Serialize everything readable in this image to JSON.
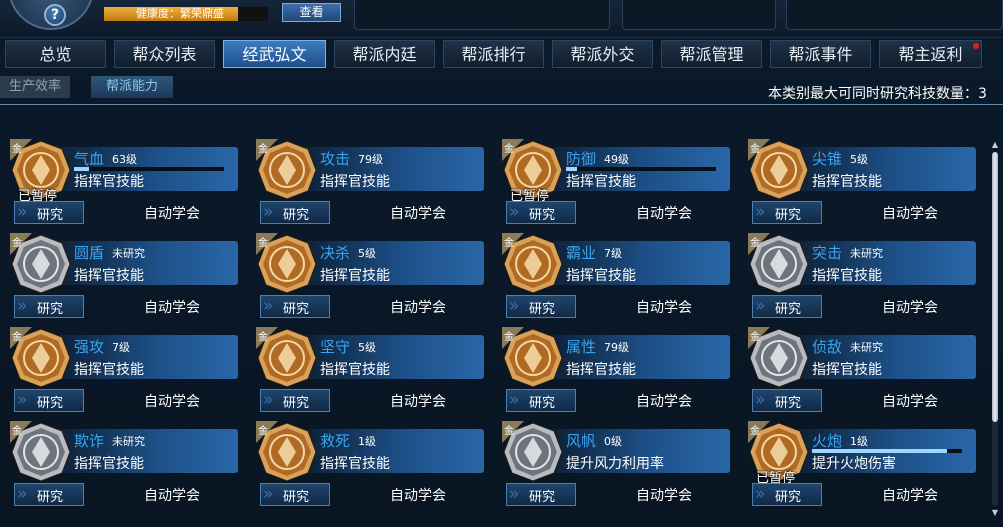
{
  "header": {
    "help_glyph": "?",
    "health_label": "健康度：繁荣鼎盛",
    "health_ratio": 0.82,
    "view_button": "查看"
  },
  "tabs": [
    {
      "label": "总览",
      "active": false
    },
    {
      "label": "帮众列表",
      "active": false
    },
    {
      "label": "经武弘文",
      "active": true
    },
    {
      "label": "帮派内廷",
      "active": false
    },
    {
      "label": "帮派排行",
      "active": false
    },
    {
      "label": "帮派外交",
      "active": false
    },
    {
      "label": "帮派管理",
      "active": false
    },
    {
      "label": "帮派事件",
      "active": false
    },
    {
      "label": "帮主返利",
      "active": false,
      "notification": true
    }
  ],
  "subtabs": {
    "production": "生产效率",
    "ability": "帮派能力"
  },
  "capacity_text": "本类别最大可同时研究科技数量：3",
  "skills": [
    {
      "grade": "金",
      "name": "气血",
      "level": "63级",
      "desc": "指挥官技能",
      "paused": "已暂停",
      "progress": 0.1,
      "research": "研究",
      "auto": "自动学会",
      "icon": "blood-icon",
      "gold": true
    },
    {
      "grade": "金",
      "name": "攻击",
      "level": "79级",
      "desc": "指挥官技能",
      "research": "研究",
      "auto": "自动学会",
      "icon": "attack-icon",
      "gold": true
    },
    {
      "grade": "金",
      "name": "防御",
      "level": "49级",
      "desc": "指挥官技能",
      "paused": "已暂停",
      "progress": 0.07,
      "research": "研究",
      "auto": "自动学会",
      "icon": "defense-icon",
      "gold": true
    },
    {
      "grade": "金",
      "name": "尖锥",
      "level": "5级",
      "desc": "指挥官技能",
      "research": "研究",
      "auto": "自动学会",
      "icon": "cone-icon",
      "gold": true
    },
    {
      "grade": "金",
      "name": "圆盾",
      "level": "未研究",
      "desc": "指挥官技能",
      "research": "研究",
      "auto": "自动学会",
      "icon": "round-shield-icon",
      "gold": false
    },
    {
      "grade": "金",
      "name": "决杀",
      "level": "5级",
      "desc": "指挥官技能",
      "research": "研究",
      "auto": "自动学会",
      "icon": "kill-icon",
      "gold": true
    },
    {
      "grade": "金",
      "name": "霸业",
      "level": "7级",
      "desc": "指挥官技能",
      "research": "研究",
      "auto": "自动学会",
      "icon": "dominion-icon",
      "gold": true
    },
    {
      "grade": "金",
      "name": "突击",
      "level": "未研究",
      "desc": "指挥官技能",
      "research": "研究",
      "auto": "自动学会",
      "icon": "assault-icon",
      "gold": false
    },
    {
      "grade": "金",
      "name": "强攻",
      "level": "7级",
      "desc": "指挥官技能",
      "research": "研究",
      "auto": "自动学会",
      "icon": "strong-attack-icon",
      "gold": true
    },
    {
      "grade": "金",
      "name": "坚守",
      "level": "5级",
      "desc": "指挥官技能",
      "research": "研究",
      "auto": "自动学会",
      "icon": "hold-icon",
      "gold": true
    },
    {
      "grade": "金",
      "name": "属性",
      "level": "79级",
      "desc": "指挥官技能",
      "research": "研究",
      "auto": "自动学会",
      "icon": "attribute-icon",
      "gold": true
    },
    {
      "grade": "金",
      "name": "侦敌",
      "level": "未研究",
      "desc": "指挥官技能",
      "research": "研究",
      "auto": "自动学会",
      "icon": "scout-icon",
      "gold": false
    },
    {
      "grade": "金",
      "name": "欺诈",
      "level": "未研究",
      "desc": "指挥官技能",
      "research": "研究",
      "auto": "自动学会",
      "icon": "deceit-icon",
      "gold": false
    },
    {
      "grade": "金",
      "name": "救死",
      "level": "1级",
      "desc": "指挥官技能",
      "research": "研究",
      "auto": "自动学会",
      "icon": "rescue-icon",
      "gold": true
    },
    {
      "grade": "金",
      "name": "风帆",
      "level": "0级",
      "desc": "提升风力利用率",
      "research": "研究",
      "auto": "自动学会",
      "icon": "sail-icon",
      "gold": false
    },
    {
      "grade": "金",
      "name": "火炮",
      "level": "1级",
      "desc": "提升火炮伤害",
      "paused": "已暂停",
      "progress": 0.9,
      "research": "研究",
      "auto": "自动学会",
      "icon": "cannon-icon",
      "gold": true
    }
  ]
}
